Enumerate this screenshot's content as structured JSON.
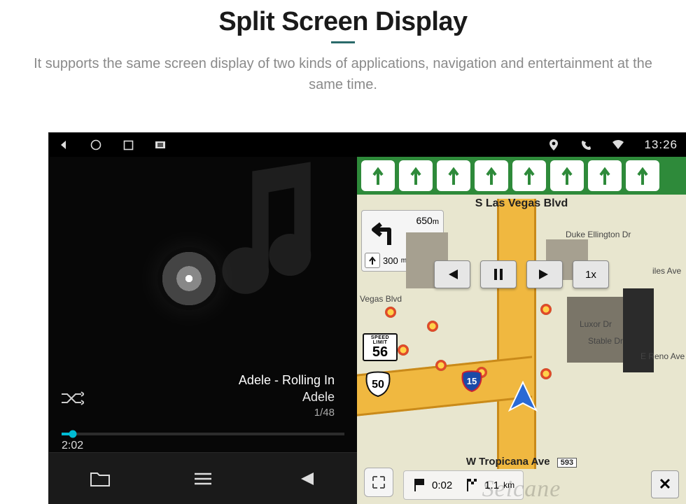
{
  "header": {
    "title": "Split Screen Display",
    "subtitle": "It supports the same screen display of two kinds of applications, navigation and entertainment at the same time."
  },
  "statusbar": {
    "time": "13:26"
  },
  "music": {
    "track_title": "Adele - Rolling In",
    "artist": "Adele",
    "track_index": "1/48",
    "elapsed": "2:02"
  },
  "nav": {
    "street_top": "S Las Vegas Blvd",
    "turn_distance_main": "650",
    "turn_distance_main_unit": "m",
    "turn_distance_sub": "300",
    "turn_distance_sub_unit": "m",
    "speed_limit_label": "SPEED LIMIT",
    "speed_limit": "56",
    "route_shield": "50",
    "interstate": "15",
    "playback_speed": "1x",
    "poi_vegas": "Vegas Blvd",
    "poi_duke": "Duke Ellington Dr",
    "poi_luxor": "Luxor Dr",
    "poi_stable": "Stable Dr",
    "poi_reno": "E Reno Ave",
    "poi_iles": "iles Ave",
    "street_bottom": "W Tropicana Ave",
    "exit": "593",
    "eta_time": "0:02",
    "eta_dist": "1.1",
    "eta_dist_unit": "km"
  },
  "watermark": "Seicane"
}
